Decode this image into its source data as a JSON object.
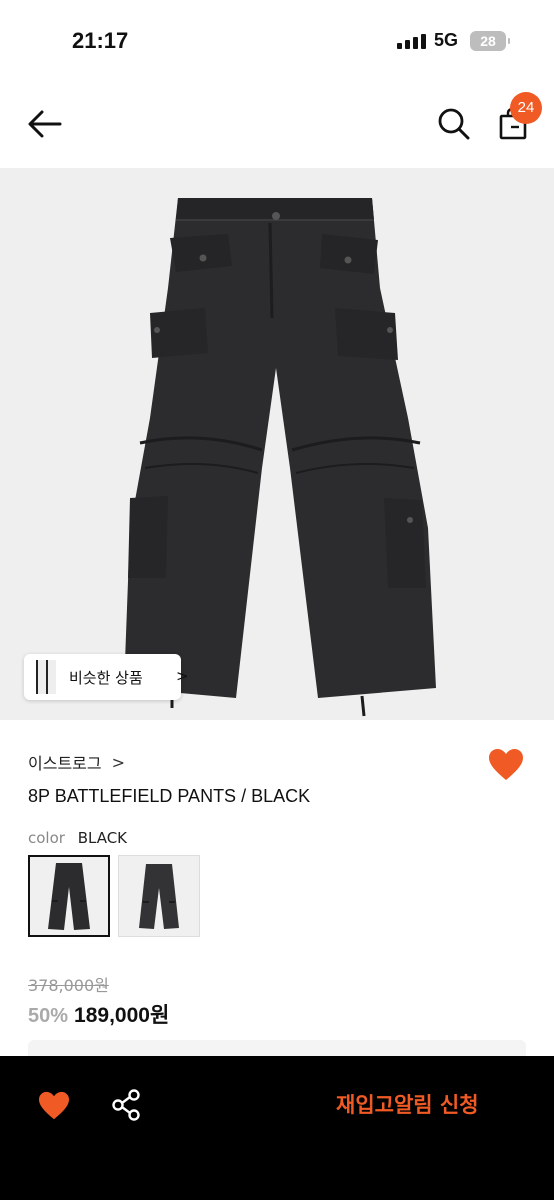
{
  "status_bar": {
    "time": "21:17",
    "network": "5G",
    "battery": "28"
  },
  "header": {
    "back_icon": "arrow-left-icon",
    "search_icon": "search-icon",
    "bag_icon": "shopping-bag-icon",
    "bag_count": "24"
  },
  "product_image": {
    "description_icon": "cargo-pants-image",
    "similar_products_label": "비슷한 상품",
    "similar_products_arrow": ">"
  },
  "product": {
    "brand": "이스트로그",
    "brand_chevron": ">",
    "title": "8P BATTLEFIELD PANTS / BLACK",
    "color_label": "color",
    "color_value": "BLACK",
    "original_price": "378,000원",
    "discount": "50%",
    "sale_price": "189,000원"
  },
  "bottom_bar": {
    "restock_label": "재입고알림 신청"
  },
  "colors": {
    "accent": "#f05a24",
    "pants": "#2c2c2e",
    "background_image": "#efefef",
    "bottom_bar": "#000000"
  }
}
